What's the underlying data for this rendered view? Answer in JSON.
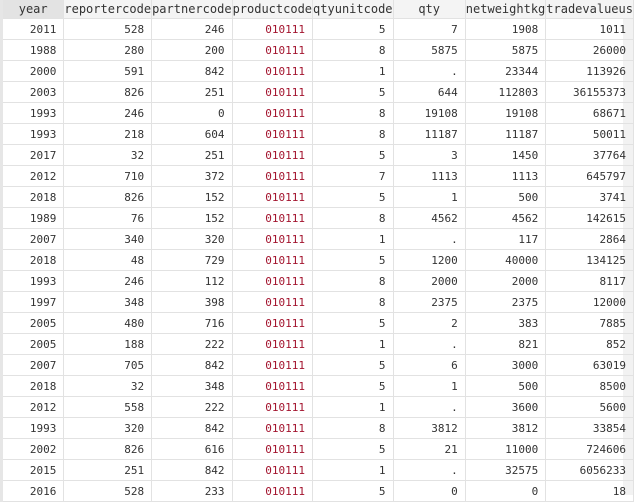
{
  "columns": [
    "year",
    "reportercode",
    "partnercode",
    "productcode",
    "qtyunitcode",
    "qty",
    "netweightkg",
    "tradevalueus"
  ],
  "colors": {
    "string_value": "#a3142e",
    "text": "#333333",
    "header_bg": "#f4f4f4",
    "selected_header_bg": "#e3e3e3"
  },
  "rows": [
    [
      "2011",
      "528",
      "246",
      "010111",
      "5",
      "7",
      "1908",
      "1011"
    ],
    [
      "1988",
      "280",
      "200",
      "010111",
      "8",
      "5875",
      "5875",
      "26000"
    ],
    [
      "2000",
      "591",
      "842",
      "010111",
      "1",
      ".",
      "23344",
      "113926"
    ],
    [
      "2003",
      "826",
      "251",
      "010111",
      "5",
      "644",
      "112803",
      "36155373"
    ],
    [
      "1993",
      "246",
      "0",
      "010111",
      "8",
      "19108",
      "19108",
      "68671"
    ],
    [
      "1993",
      "218",
      "604",
      "010111",
      "8",
      "11187",
      "11187",
      "50011"
    ],
    [
      "2017",
      "32",
      "251",
      "010111",
      "5",
      "3",
      "1450",
      "37764"
    ],
    [
      "2012",
      "710",
      "372",
      "010111",
      "7",
      "1113",
      "1113",
      "645797"
    ],
    [
      "2018",
      "826",
      "152",
      "010111",
      "5",
      "1",
      "500",
      "3741"
    ],
    [
      "1989",
      "76",
      "152",
      "010111",
      "8",
      "4562",
      "4562",
      "142615"
    ],
    [
      "2007",
      "340",
      "320",
      "010111",
      "1",
      ".",
      "117",
      "2864"
    ],
    [
      "2018",
      "48",
      "729",
      "010111",
      "5",
      "1200",
      "40000",
      "134125"
    ],
    [
      "1993",
      "246",
      "112",
      "010111",
      "8",
      "2000",
      "2000",
      "8117"
    ],
    [
      "1997",
      "348",
      "398",
      "010111",
      "8",
      "2375",
      "2375",
      "12000"
    ],
    [
      "2005",
      "480",
      "716",
      "010111",
      "5",
      "2",
      "383",
      "7885"
    ],
    [
      "2005",
      "188",
      "222",
      "010111",
      "1",
      ".",
      "821",
      "852"
    ],
    [
      "2007",
      "705",
      "842",
      "010111",
      "5",
      "6",
      "3000",
      "63019"
    ],
    [
      "2018",
      "32",
      "348",
      "010111",
      "5",
      "1",
      "500",
      "8500"
    ],
    [
      "2012",
      "558",
      "222",
      "010111",
      "1",
      ".",
      "3600",
      "5600"
    ],
    [
      "1993",
      "320",
      "842",
      "010111",
      "8",
      "3812",
      "3812",
      "33854"
    ],
    [
      "2002",
      "826",
      "616",
      "010111",
      "5",
      "21",
      "11000",
      "724606"
    ],
    [
      "2015",
      "251",
      "842",
      "010111",
      "1",
      ".",
      "32575",
      "6056233"
    ],
    [
      "2016",
      "528",
      "233",
      "010111",
      "5",
      "0",
      "0",
      "18"
    ]
  ]
}
